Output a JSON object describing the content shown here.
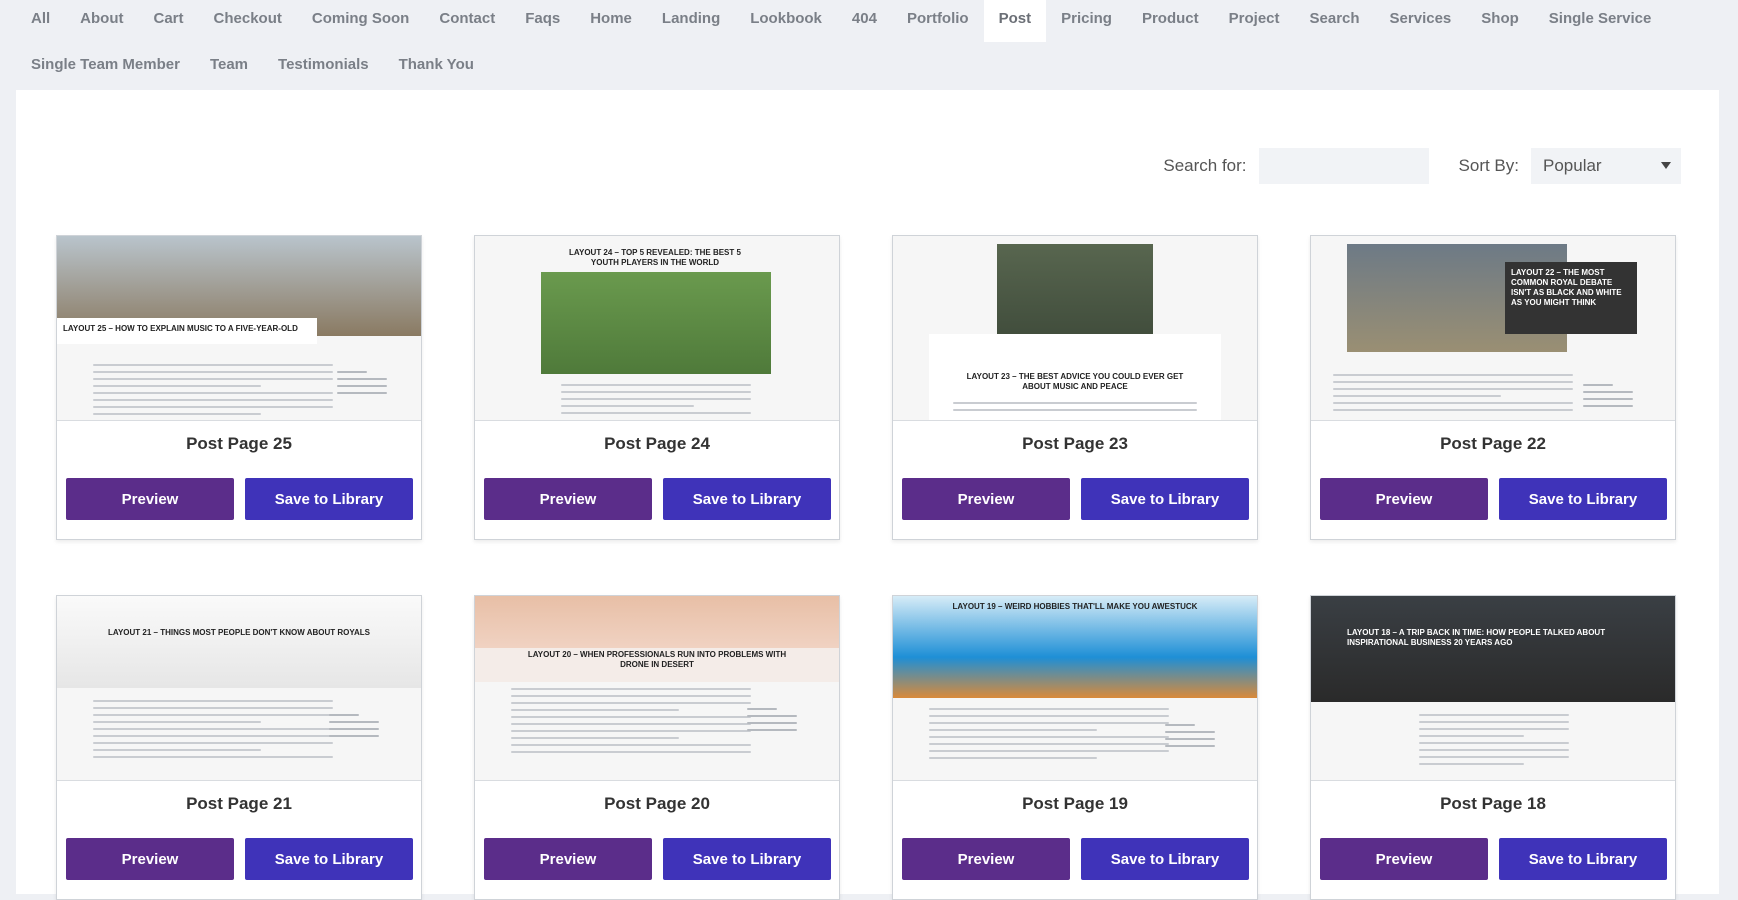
{
  "tabs": [
    {
      "label": "All"
    },
    {
      "label": "About"
    },
    {
      "label": "Cart"
    },
    {
      "label": "Checkout"
    },
    {
      "label": "Coming Soon"
    },
    {
      "label": "Contact"
    },
    {
      "label": "Faqs"
    },
    {
      "label": "Home"
    },
    {
      "label": "Landing"
    },
    {
      "label": "Lookbook"
    },
    {
      "label": "404"
    },
    {
      "label": "Portfolio"
    },
    {
      "label": "Post"
    },
    {
      "label": "Pricing"
    },
    {
      "label": "Product"
    },
    {
      "label": "Project"
    },
    {
      "label": "Search"
    },
    {
      "label": "Services"
    },
    {
      "label": "Shop"
    },
    {
      "label": "Single Service"
    },
    {
      "label": "Single Team Member"
    },
    {
      "label": "Team"
    },
    {
      "label": "Testimonials"
    },
    {
      "label": "Thank You"
    }
  ],
  "active_tab": "Post",
  "filters": {
    "search_label": "Search for:",
    "search_value": "",
    "sort_label": "Sort By:",
    "sort_value": "Popular"
  },
  "buttons": {
    "preview": "Preview",
    "save": "Save to Library"
  },
  "cards": [
    {
      "title": "Post Page 25",
      "thumb_heading": "LAYOUT 25 – HOW TO EXPLAIN MUSIC TO A FIVE-YEAR-OLD",
      "theme": "photo-top",
      "photo_color": "#8a7a62",
      "sky": "#b9c4cc"
    },
    {
      "title": "Post Page 24",
      "thumb_heading": "Layout 24 – Top 5 Revealed: The Best 5 Youth Players in the World",
      "theme": "photo-center",
      "photo_color": "#4f7a3a",
      "sky": "#6a9a4e"
    },
    {
      "title": "Post Page 23",
      "thumb_heading": "Layout 23 – The Best Advice You Could Ever Get About Music And Peace",
      "theme": "photo-card",
      "photo_color": "#3e4a3a",
      "sky": "#58664f"
    },
    {
      "title": "Post Page 22",
      "thumb_heading": "Layout 22 – The Most Common Royal Debate Isn't as Black and White as You Might Think",
      "theme": "photo-overlay",
      "photo_color": "#9a8f73",
      "sky": "#6d7a86"
    },
    {
      "title": "Post Page 21",
      "thumb_heading": "LAYOUT 21 – THINGS MOST PEOPLE DON'T KNOW ABOUT ROYALS",
      "theme": "light",
      "photo_color": "#f2f2f2",
      "sky": "#e6e6e6"
    },
    {
      "title": "Post Page 20",
      "thumb_heading": "LAYOUT 20 – WHEN PROFESSIONALS RUN INTO PROBLEMS WITH DRONE IN DESERT",
      "theme": "pink",
      "photo_color": "#e8bfa6",
      "sky": "#f0d2c2"
    },
    {
      "title": "Post Page 19",
      "thumb_heading": "LAYOUT 19 – WEIRD HOBBIES THAT'LL MAKE YOU AWESTUCK",
      "theme": "coast",
      "photo_color": "#1e8fd6",
      "sky": "#d6ecf7"
    },
    {
      "title": "Post Page 18",
      "thumb_heading": "Layout 18 – A Trip Back in Time: How People Talked About Inspirational Business 20 Years Ago",
      "theme": "dark",
      "photo_color": "#2a2a2a",
      "sky": "#3a3f44"
    }
  ]
}
